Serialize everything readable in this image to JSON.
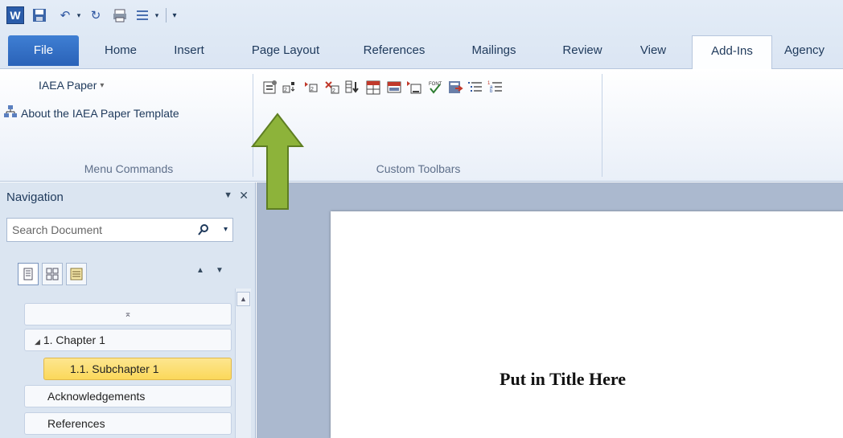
{
  "quick_access": {
    "word_logo": "W",
    "icons": [
      "save-icon",
      "undo-icon",
      "redo-icon",
      "print-preview-icon",
      "format-icon",
      "customize-qat-icon"
    ]
  },
  "tabs": [
    {
      "label": "File"
    },
    {
      "label": "Home"
    },
    {
      "label": "Insert"
    },
    {
      "label": "Page Layout"
    },
    {
      "label": "References"
    },
    {
      "label": "Mailings"
    },
    {
      "label": "Review"
    },
    {
      "label": "View"
    },
    {
      "label": "Add-Ins"
    },
    {
      "label": "Agency"
    }
  ],
  "ribbon": {
    "menu_commands": {
      "iaea_paper": "IAEA Paper",
      "dropdown_glyph": "▾",
      "about": "About the IAEA Paper Template",
      "group_label": "Menu Commands"
    },
    "custom_toolbars": {
      "group_label": "Custom Toolbars"
    }
  },
  "navigation": {
    "title": "Navigation",
    "search_placeholder": "Search Document",
    "items": [
      {
        "label": "1. Chapter 1"
      },
      {
        "label": "1.1. Subchapter 1"
      },
      {
        "label": "Acknowledgements"
      },
      {
        "label": "References"
      }
    ]
  },
  "document": {
    "title": "Put in Title Here"
  },
  "colors": {
    "accent": "#2a62b8",
    "highlight": "#fbd85a",
    "arrow": "#8db33a"
  }
}
